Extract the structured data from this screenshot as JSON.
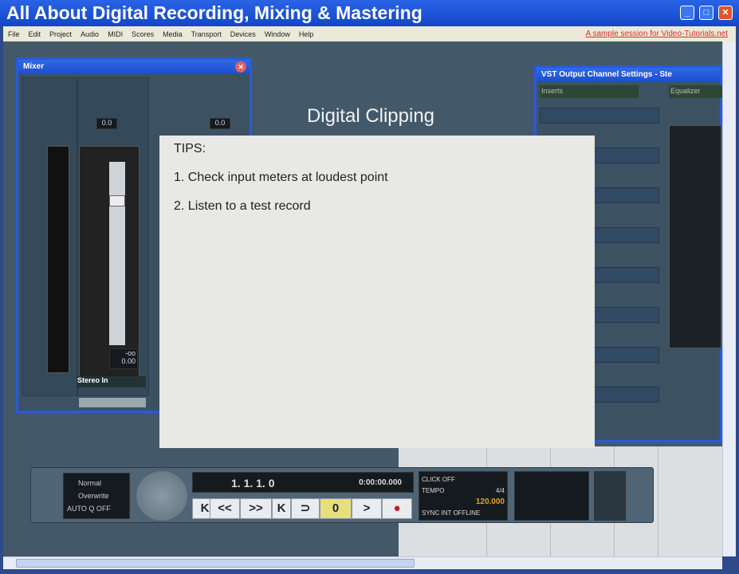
{
  "window": {
    "title": "All About Digital Recording, Mixing & Mastering",
    "minimize": "_",
    "maximize": "□",
    "close": "✕"
  },
  "menu": {
    "items": [
      "File",
      "Edit",
      "Project",
      "Audio",
      "MIDI",
      "Scores",
      "Media",
      "Transport",
      "Devices",
      "Window",
      "Help"
    ],
    "promo": "A sample session for Video-Tutorials.net"
  },
  "mixer": {
    "title": "Mixer",
    "close": "✕",
    "channel_value": "0.0",
    "fader_value": "-oo",
    "fader_value2": "0.00",
    "channel_name": "Stereo In"
  },
  "vst": {
    "title": "VST Output Channel Settings - Ste",
    "inserts": "Inserts",
    "equalizer": "Equalizer"
  },
  "slide": {
    "heading": "Digital Clipping",
    "tips_title": "TIPS:",
    "tips": [
      "1. Check input meters at loudest point",
      "2. Listen to a test record"
    ]
  },
  "transport": {
    "mode1": "Normal",
    "mode2": "Overwrite",
    "auto_q": "AUTO Q",
    "off": "OFF",
    "position": "1. 1. 1.   0",
    "time": "0:00:00.000",
    "click": "CLICK",
    "click_off": "OFF",
    "tempo_label": "TEMPO",
    "tempo": "120.000",
    "sig": "4/4",
    "sync": "SYNC",
    "int": "INT",
    "offline": "OFFLINE",
    "buttons": [
      "K",
      "<<",
      ">>",
      "K",
      "⊃",
      "0",
      ">",
      "●"
    ]
  },
  "colors": {
    "titlebar": "#1346c8",
    "workspace": "#43596a",
    "record": "#d0102a",
    "cycle_active": "#e6e07a"
  }
}
